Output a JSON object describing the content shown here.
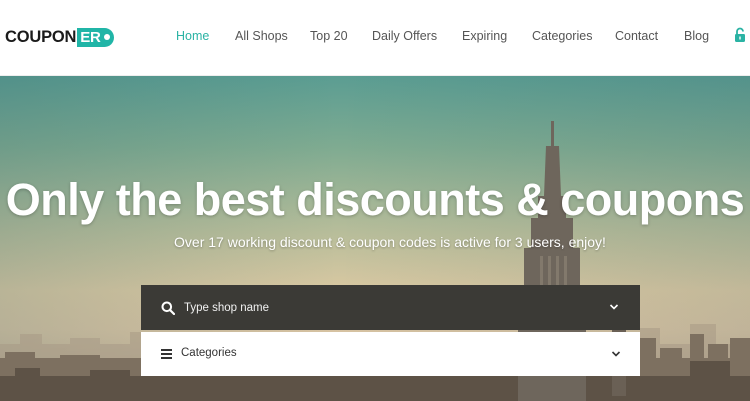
{
  "brand": {
    "logo_text": "COUPON",
    "logo_badge": "ER",
    "accent_color": "#20b5a7"
  },
  "nav": {
    "items": [
      {
        "label": "Home",
        "active": true
      },
      {
        "label": "All Shops",
        "active": false
      },
      {
        "label": "Top 20",
        "active": false
      },
      {
        "label": "Daily Offers",
        "active": false
      },
      {
        "label": "Expiring",
        "active": false
      },
      {
        "label": "Categories",
        "active": false
      },
      {
        "label": "Contact",
        "active": false
      },
      {
        "label": "Blog",
        "active": false
      }
    ],
    "login_icon": "lock-icon"
  },
  "hero": {
    "headline": "Only the best discounts & coupons",
    "subline": "Over 17 working discount & coupon codes is active for 3 users, enjoy!"
  },
  "search": {
    "placeholder": "Type shop name",
    "icon": "search-icon",
    "dropdown_icon": "chevron-down-icon"
  },
  "categories": {
    "label": "Categories",
    "icon": "menu-icon",
    "dropdown_icon": "chevron-down-icon"
  }
}
